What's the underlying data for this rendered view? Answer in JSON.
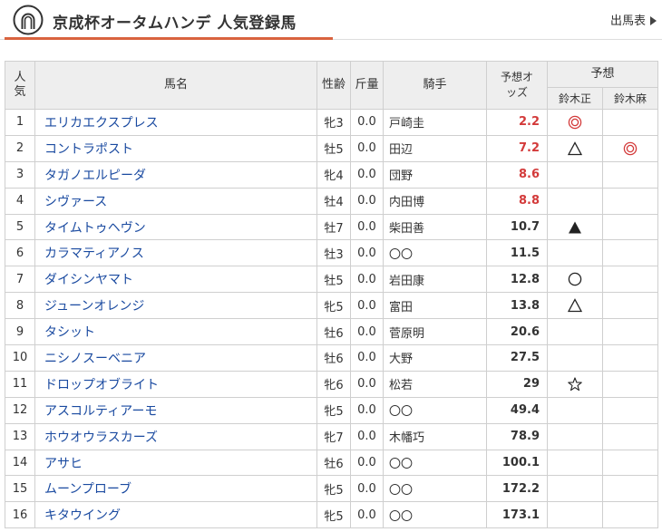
{
  "header": {
    "title": "京成杯オータムハンデ 人気登録馬",
    "link_label": "出馬表"
  },
  "table": {
    "headers": {
      "rank": "人気",
      "name": "馬名",
      "sex_age": "性齢",
      "weight": "斤量",
      "jockey": "騎手",
      "odds": "予想オッズ",
      "prediction": "予想",
      "predictor_1": "鈴木正",
      "predictor_2": "鈴木麻"
    },
    "rows": [
      {
        "rank": "1",
        "name": "エリカエクスプレス",
        "sex_age": "牝3",
        "weight": "0.0",
        "jockey": "戸崎圭",
        "odds": "2.2",
        "mark_1": "double-circle",
        "mark_2": ""
      },
      {
        "rank": "2",
        "name": "コントラポスト",
        "sex_age": "牡5",
        "weight": "0.0",
        "jockey": "田辺",
        "odds": "7.2",
        "mark_1": "triangle",
        "mark_2": "double-circle"
      },
      {
        "rank": "3",
        "name": "タガノエルピーダ",
        "sex_age": "牝4",
        "weight": "0.0",
        "jockey": "団野",
        "odds": "8.6",
        "mark_1": "",
        "mark_2": ""
      },
      {
        "rank": "4",
        "name": "シヴァース",
        "sex_age": "牡4",
        "weight": "0.0",
        "jockey": "内田博",
        "odds": "8.8",
        "mark_1": "",
        "mark_2": ""
      },
      {
        "rank": "5",
        "name": "タイムトゥヘヴン",
        "sex_age": "牡7",
        "weight": "0.0",
        "jockey": "柴田善",
        "odds": "10.7",
        "mark_1": "filled-triangle",
        "mark_2": ""
      },
      {
        "rank": "6",
        "name": "カラマティアノス",
        "sex_age": "牡3",
        "weight": "0.0",
        "jockey": "〇〇",
        "odds": "11.5",
        "mark_1": "",
        "mark_2": ""
      },
      {
        "rank": "7",
        "name": "ダイシンヤマト",
        "sex_age": "牡5",
        "weight": "0.0",
        "jockey": "岩田康",
        "odds": "12.8",
        "mark_1": "circle",
        "mark_2": ""
      },
      {
        "rank": "8",
        "name": "ジューンオレンジ",
        "sex_age": "牝5",
        "weight": "0.0",
        "jockey": "富田",
        "odds": "13.8",
        "mark_1": "triangle",
        "mark_2": ""
      },
      {
        "rank": "9",
        "name": "タシット",
        "sex_age": "牡6",
        "weight": "0.0",
        "jockey": "菅原明",
        "odds": "20.6",
        "mark_1": "",
        "mark_2": ""
      },
      {
        "rank": "10",
        "name": "ニシノスーベニア",
        "sex_age": "牡6",
        "weight": "0.0",
        "jockey": "大野",
        "odds": "27.5",
        "mark_1": "",
        "mark_2": ""
      },
      {
        "rank": "11",
        "name": "ドロップオブライト",
        "sex_age": "牝6",
        "weight": "0.0",
        "jockey": "松若",
        "odds": "29",
        "mark_1": "star",
        "mark_2": ""
      },
      {
        "rank": "12",
        "name": "アスコルティアーモ",
        "sex_age": "牝5",
        "weight": "0.0",
        "jockey": "〇〇",
        "odds": "49.4",
        "mark_1": "",
        "mark_2": ""
      },
      {
        "rank": "13",
        "name": "ホウオウラスカーズ",
        "sex_age": "牝7",
        "weight": "0.0",
        "jockey": "木幡巧",
        "odds": "78.9",
        "mark_1": "",
        "mark_2": ""
      },
      {
        "rank": "14",
        "name": "アサヒ",
        "sex_age": "牡6",
        "weight": "0.0",
        "jockey": "〇〇",
        "odds": "100.1",
        "mark_1": "",
        "mark_2": ""
      },
      {
        "rank": "15",
        "name": "ムーンプローブ",
        "sex_age": "牝5",
        "weight": "0.0",
        "jockey": "〇〇",
        "odds": "172.2",
        "mark_1": "",
        "mark_2": ""
      },
      {
        "rank": "16",
        "name": "キタウイング",
        "sex_age": "牝5",
        "weight": "0.0",
        "jockey": "〇〇",
        "odds": "173.1",
        "mark_1": "",
        "mark_2": ""
      }
    ]
  },
  "colors": {
    "accent_line": "#d9633f",
    "favorite_odds": "#d33a3a",
    "horse_link": "#1a4aa0",
    "mark_red": "#d33a3a",
    "mark_black": "#222222"
  }
}
